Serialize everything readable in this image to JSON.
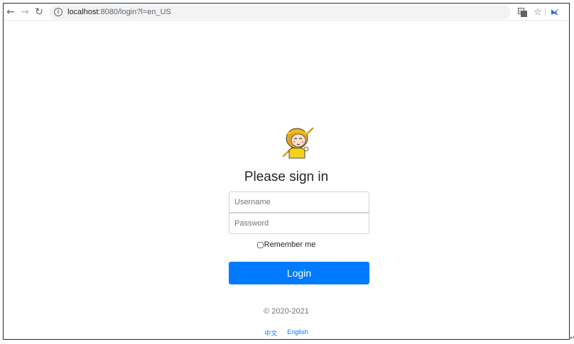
{
  "browser": {
    "url_host": "localhost",
    "url_rest": ":8080/login?l=en_US",
    "icons": {
      "back": "arrow-left-icon",
      "forward": "arrow-right-icon",
      "reload": "reload-icon",
      "info": "info-icon",
      "translate": "translate-icon",
      "bookmark": "star-icon",
      "extension": "extension-icon"
    }
  },
  "login": {
    "title": "Please sign in",
    "username_placeholder": "Username",
    "password_placeholder": "Password",
    "remember_label": "Remember me",
    "remember_checked": false,
    "submit_label": "Login",
    "accent_color": "#007bff"
  },
  "footer": {
    "copyright": "© 2020-2021",
    "lang_zh": "中文",
    "lang_en": "English"
  }
}
